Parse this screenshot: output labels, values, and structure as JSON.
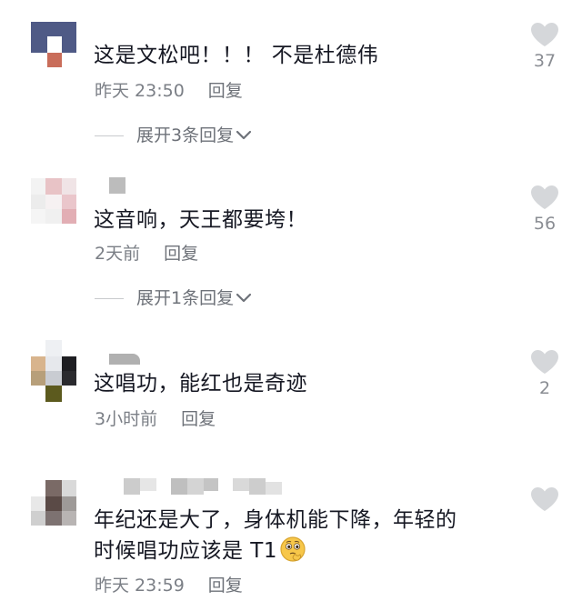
{
  "comments": [
    {
      "text": "这是文松吧！！！ 不是杜德伟",
      "time": "昨天 23:50",
      "reply": "回复",
      "expand": "展开3条回复",
      "likes": "37"
    },
    {
      "text": "这音响，天王都要垮！",
      "time": "2天前",
      "reply": "回复",
      "expand": "展开1条回复",
      "likes": "56"
    },
    {
      "text": "这唱功，能红也是奇迹",
      "time": "3小时前",
      "reply": "回复",
      "likes": "2"
    },
    {
      "text_line1": "年纪还是大了，身体机能下降，年轻的",
      "text_line2": "时候唱功应该是 T1",
      "time": "昨天 23:59",
      "reply": "回复",
      "likes": ""
    }
  ],
  "icons": {
    "like": "heart-icon",
    "expand": "chevron-down-icon",
    "emoji": "thinking-face-emoji"
  },
  "colors": {
    "text": "#161823",
    "meta": "#7b7f86",
    "heart": "#d5d7da"
  }
}
